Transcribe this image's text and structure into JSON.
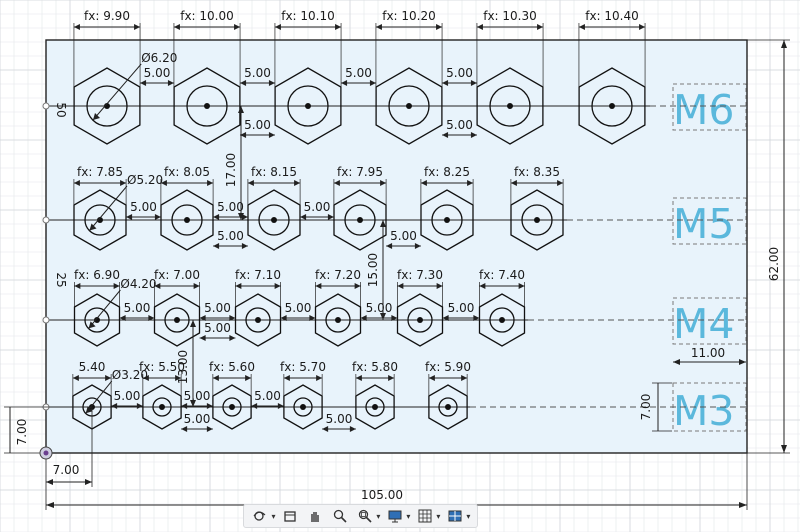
{
  "plate": {
    "width_label": "105.00",
    "height_label": "62.00",
    "origin_x_label": "7.00",
    "origin_y_label": "7.00",
    "label_col_width": "11.00",
    "label_height": "7.00"
  },
  "rows": [
    {
      "label": "M6",
      "dia": "Ø6.20",
      "side_label": "50",
      "fx": [
        "fx: 9.90",
        "fx: 10.00",
        "fx: 10.10",
        "fx: 10.20",
        "fx: 10.30",
        "fx: 10.40"
      ],
      "gaps": [
        "5.00",
        "5.00",
        "5.00",
        "5.00"
      ],
      "gap_low": [
        "5.00",
        "5.00"
      ]
    },
    {
      "label": "M5",
      "dia": "Ø5.20",
      "fx": [
        "fx: 7.85",
        "fx: 8.05",
        "fx: 8.15",
        "fx: 7.95",
        "fx: 8.25",
        "fx: 8.35"
      ],
      "gaps": [
        "5.00",
        "5.00",
        "5.00"
      ],
      "gap_low": [
        "5.00",
        "5.00"
      ]
    },
    {
      "label": "M4",
      "dia": "Ø4.20",
      "side_label": "25",
      "fx": [
        "fx: 6.90",
        "fx: 7.00",
        "fx: 7.10",
        "fx: 7.20",
        "fx: 7.30",
        "fx: 7.40"
      ],
      "gaps": [
        "5.00",
        "5.00",
        "5.00",
        "5.00",
        "5.00"
      ],
      "gap_low": [
        "5.00"
      ]
    },
    {
      "label": "M3",
      "dia": "Ø3.20",
      "fx": [
        "5.40",
        "fx: 5.50",
        "fx: 5.60",
        "fx: 5.70",
        "fx: 5.80",
        "fx: 5.90"
      ],
      "gaps": [
        "5.00",
        "5.00",
        "5.00"
      ],
      "gap_low": [
        "5.00",
        "5.00"
      ]
    }
  ],
  "vertical_dims": [
    "17.00",
    "15.00",
    "13.00"
  ],
  "colors": {
    "plate": "#e8f3fb",
    "plate_border": "#222222",
    "label": "#5bb8dc",
    "grid": "#dfe2e6"
  },
  "toolbar": {
    "icons": [
      "orbit-icon",
      "look-at-icon",
      "pan-icon",
      "zoom-icon",
      "zoom-window-icon",
      "display-settings-icon",
      "grid-settings-icon",
      "viewports-icon"
    ]
  }
}
